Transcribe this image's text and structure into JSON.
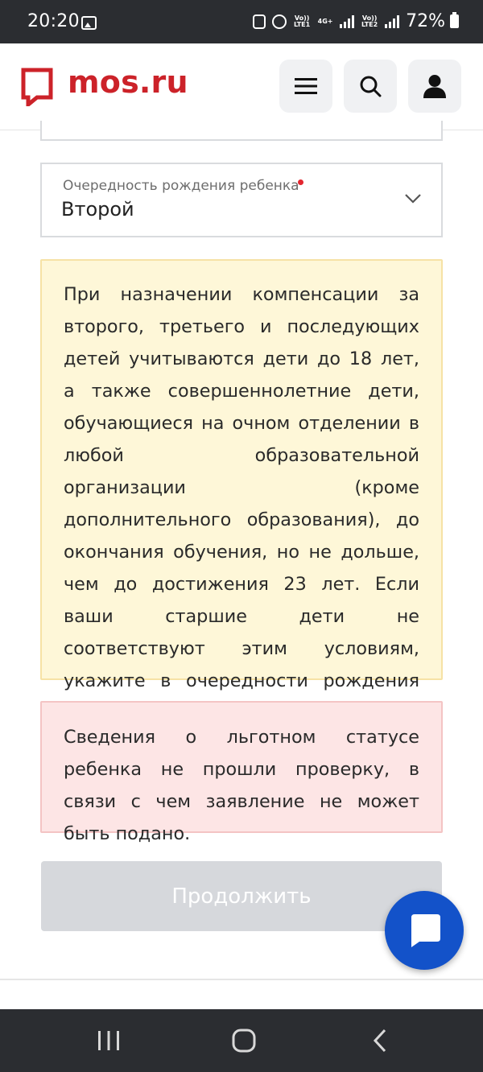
{
  "status_bar": {
    "time": "20:20",
    "lte1": "Vo)) LTE1",
    "net": "4G+",
    "lte2": "Vo)) LTE2",
    "battery": "72%",
    "icons": [
      "gallery-icon",
      "battery-saver-icon",
      "alarm-icon",
      "signal-icon",
      "battery-icon"
    ]
  },
  "header": {
    "logo_text": "mos.ru",
    "brand_color": "#cc2229",
    "buttons": [
      "menu-icon",
      "search-icon",
      "user-icon"
    ]
  },
  "form": {
    "birth_order": {
      "label": "Очередность рождения ребенка",
      "value": "Второй",
      "required": true
    }
  },
  "info_notice": {
    "text": "При назначении компенсации за второго, третьего и последующих детей учитываются дети до 18 лет, а также совершеннолетние дети, обучающиеся на очном отделении в любой образовательной организации (кроме дополнительного образования), до окончания обучения, но не дольше, чем до достижения 23 лет. Если ваши старшие дети не соответствуют этим условиям, укажите в очередности рождения ребенка – «первый»."
  },
  "error_notice": {
    "text": "Сведения о льготном статусе ребенка не прошли проверку, в связи с чем заявление не может быть подано."
  },
  "actions": {
    "continue_label": "Продолжить",
    "continue_disabled": true
  },
  "chat": {
    "icon": "chat-icon",
    "color": "#1352c9"
  },
  "nav_bar": {
    "items": [
      "recent-apps-icon",
      "home-icon",
      "back-icon"
    ]
  }
}
